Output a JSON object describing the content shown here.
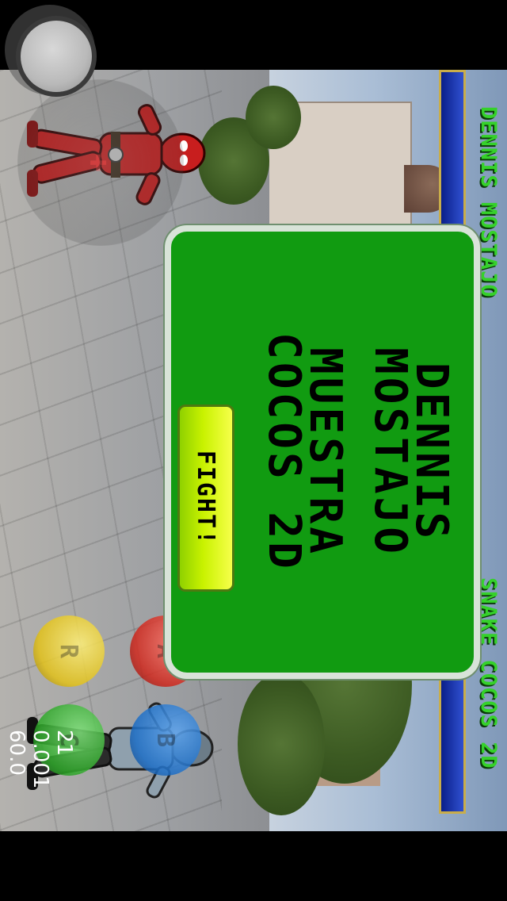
{
  "hud": {
    "player1_name": "DENNIS MOSTAJO",
    "player2_name": "SNAKE COCOS 2D",
    "player1_health": 1.0,
    "player2_health": 1.0,
    "health_color": "#0b2a9a",
    "name_color": "#35d12a"
  },
  "dialog": {
    "line1": "DENNIS",
    "line2": "MOSTAJO",
    "line3": "MUESTRA",
    "line4": "COCOS 2D",
    "fight_label": "FIGHT!",
    "panel_color": "#119b11",
    "button_color": "#d8f400"
  },
  "buttons": [
    {
      "icon": "button-b-icon",
      "color": "#1e6fc7"
    },
    {
      "icon": "button-c-icon",
      "color": "#2fa82a"
    },
    {
      "icon": "button-a-icon",
      "color": "#d0291e"
    },
    {
      "icon": "button-r-icon",
      "color": "#e3c21a"
    }
  ],
  "stats": {
    "line1": "21",
    "line2": "0.001",
    "line3": "60.0"
  },
  "joystick": {
    "icon": "joystick-icon"
  }
}
